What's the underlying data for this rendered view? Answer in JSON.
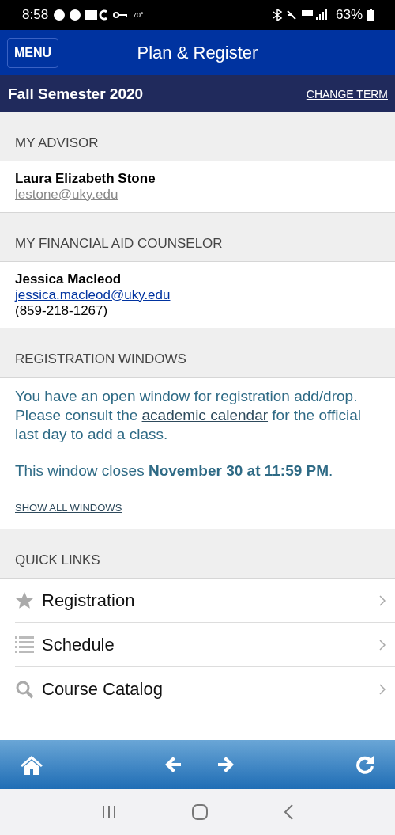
{
  "status_bar": {
    "time": "8:58",
    "temperature": "70°",
    "battery": "63%"
  },
  "header": {
    "menu_button": "MENU",
    "title": "Plan & Register"
  },
  "term_bar": {
    "term": "Fall Semester 2020",
    "change_link": "CHANGE TERM"
  },
  "advisor": {
    "heading": "MY ADVISOR",
    "name": "Laura Elizabeth Stone",
    "email": "lestone@uky.edu"
  },
  "counselor": {
    "heading": "MY FINANCIAL AID COUNSELOR",
    "name": "Jessica Macleod",
    "email": "jessica.macleod@uky.edu",
    "phone": "(859-218-1267)"
  },
  "registration_windows": {
    "heading": "REGISTRATION WINDOWS",
    "message_before": "You have an open window for registration add/drop. Please consult the ",
    "message_link": "academic calendar",
    "message_after": " for the official last day to add a class.",
    "closes": "This window closes **November 30 at 11:59 PM**.",
    "show_all_link": "SHOW ALL WINDOWS"
  },
  "quick_links": {
    "heading": "QUICK LINKS",
    "items": [
      {
        "kind": "star",
        "label": "Registration"
      },
      {
        "kind": "list",
        "label": "Schedule"
      },
      {
        "kind": "search",
        "label": "Course Catalog"
      }
    ]
  }
}
